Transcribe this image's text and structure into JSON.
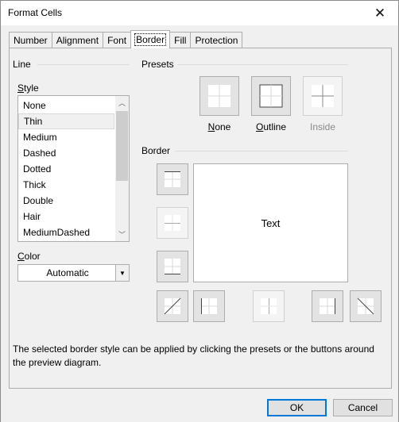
{
  "window": {
    "title": "Format Cells"
  },
  "tabs": [
    {
      "label": "Number"
    },
    {
      "label": "Alignment"
    },
    {
      "label": "Font"
    },
    {
      "label": "Border",
      "active": true
    },
    {
      "label": "Fill"
    },
    {
      "label": "Protection"
    }
  ],
  "line": {
    "heading": "Line",
    "style_label_first": "S",
    "style_label_rest": "tyle",
    "styles": [
      "None",
      "Thin",
      "Medium",
      "Dashed",
      "Dotted",
      "Thick",
      "Double",
      "Hair",
      "MediumDashed"
    ],
    "selected_style": "Thin",
    "color_label_first": "C",
    "color_label_rest": "olor",
    "color_value": "Automatic"
  },
  "presets": {
    "heading": "Presets",
    "none": {
      "first": "N",
      "rest": "one"
    },
    "outline": {
      "first": "O",
      "rest": "utline"
    },
    "inside": {
      "label": "Inside"
    }
  },
  "border": {
    "heading": "Border",
    "preview_text": "Text"
  },
  "hint": "The selected border style can be applied by clicking the presets or the buttons around the preview diagram.",
  "footer": {
    "ok_label": "OK",
    "cancel_label": "Cancel"
  },
  "colors": {
    "accent": "#0078d7",
    "button_face": "#e3e3e3",
    "window_bg": "#f0f0f0"
  }
}
